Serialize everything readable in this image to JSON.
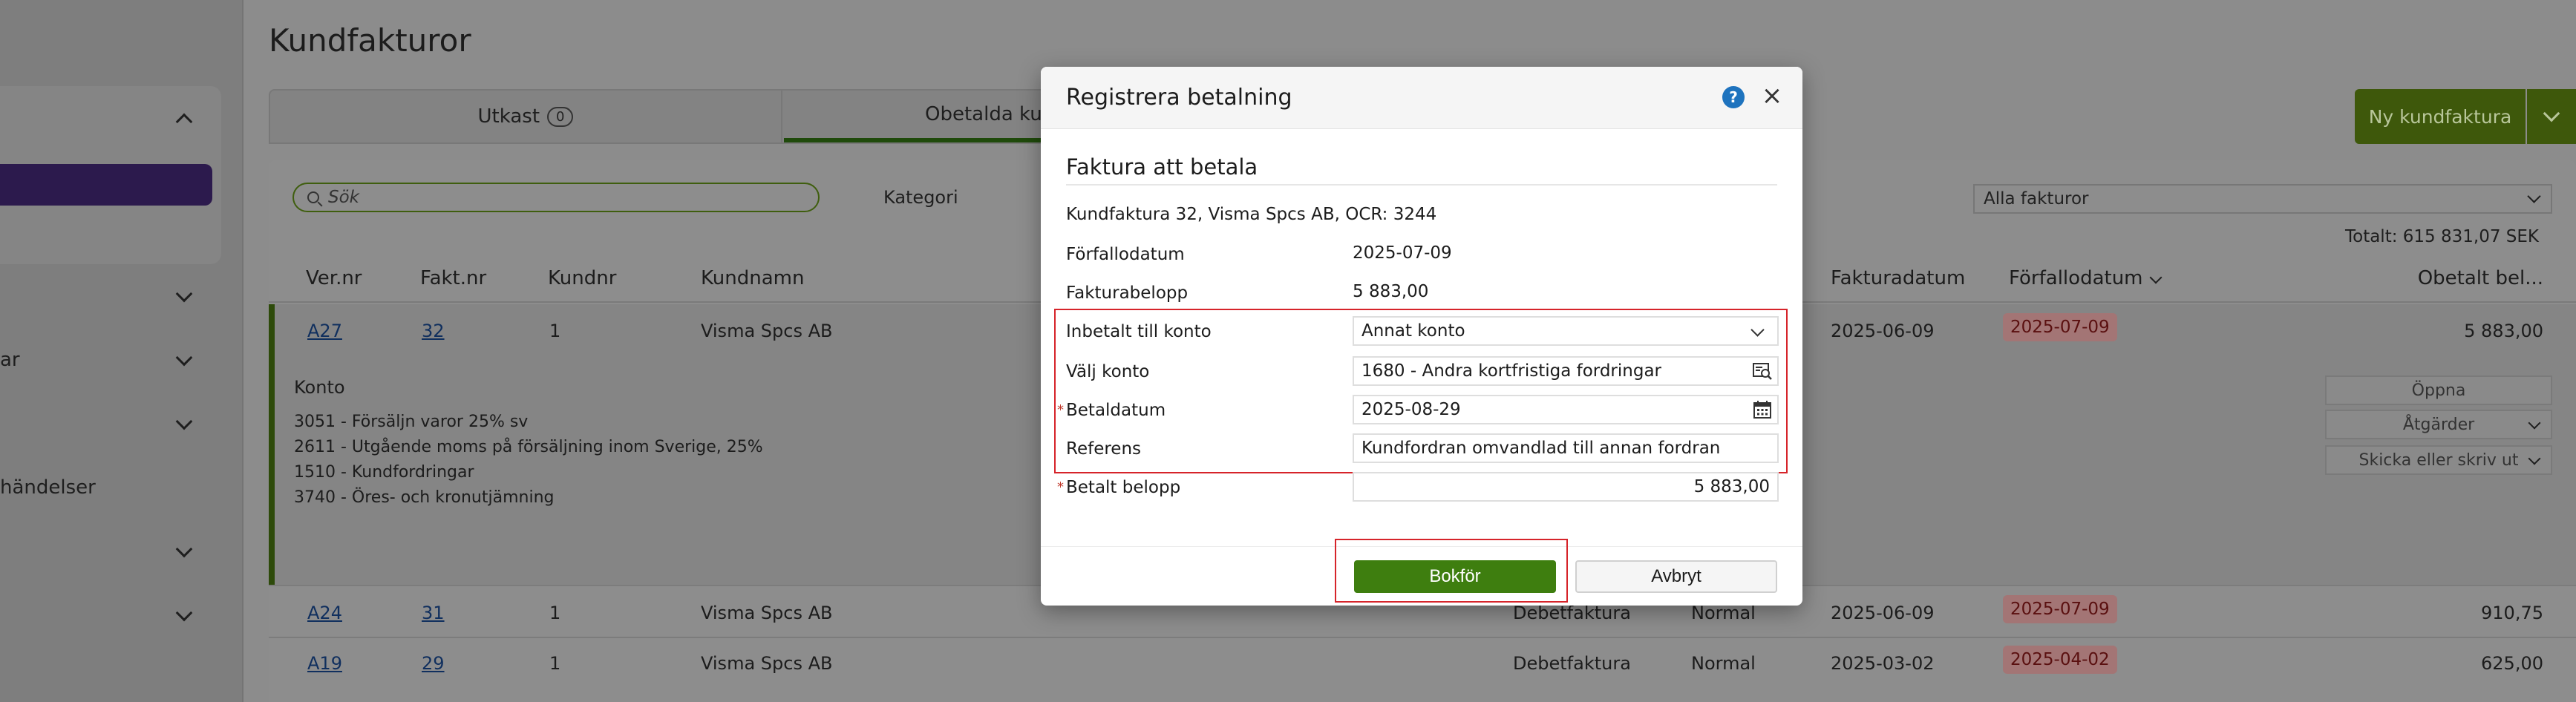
{
  "page": {
    "title": "Kundfakturor"
  },
  "sidebar": {
    "items": [
      {
        "label": ""
      },
      {
        "label": "ar"
      },
      {
        "label": "händelser"
      }
    ]
  },
  "tabs": [
    {
      "label": "Utkast",
      "count": "0"
    },
    {
      "label": "Obetalda kund"
    }
  ],
  "toolbar": {
    "new_invoice_label": "Ny kundfaktura",
    "search_placeholder": "Sök",
    "category_label": "Kategori",
    "filter_value": "Alla fakturor",
    "total": "Totalt: 615 831,07 SEK"
  },
  "table": {
    "columns": [
      "Ver.nr",
      "Fakt.nr",
      "Kundnr",
      "Kundnamn",
      "Fakturadatum",
      "Förfallodatum",
      "Obetalt bel..."
    ],
    "rows": [
      {
        "ver": "A27",
        "fakt": "32",
        "kund": "1",
        "namn": "Visma Spcs AB",
        "typ": "",
        "status": "",
        "fdatum": "2025-06-09",
        "due": "2025-07-09",
        "belopp": "5 883,00"
      },
      {
        "ver": "A24",
        "fakt": "31",
        "kund": "1",
        "namn": "Visma Spcs AB",
        "typ": "Debetfaktura",
        "status": "Normal",
        "fdatum": "2025-06-09",
        "due": "2025-07-09",
        "belopp": "910,75"
      },
      {
        "ver": "A19",
        "fakt": "29",
        "kund": "1",
        "namn": "Visma Spcs AB",
        "typ": "Debetfaktura",
        "status": "Normal",
        "fdatum": "2025-03-02",
        "due": "2025-04-02",
        "belopp": "625,00"
      }
    ],
    "expanded": {
      "konto_title": "Konto",
      "konto_lines": [
        "3051 - Försäljn varor 25% sv",
        "2611 - Utgående moms på försäljning inom Sverige, 25%",
        "1510 - Kundfordringar",
        "3740 - Öres- och kronutjämning"
      ],
      "actions": [
        "Öppna",
        "Åtgärder",
        "Skicka eller skriv ut"
      ]
    }
  },
  "modal": {
    "title": "Registrera betalning",
    "section_title": "Faktura att betala",
    "invoice_info": "Kundfaktura 32, Visma Spcs AB, OCR: 3244",
    "forfallodatum_label": "Förfallodatum",
    "forfallodatum_value": "2025-07-09",
    "fakturabelopp_label": "Fakturabelopp",
    "fakturabelopp_value": "5 883,00",
    "inbetalt_label": "Inbetalt till konto",
    "inbetalt_value": "Annat konto",
    "valj_konto_label": "Välj konto",
    "valj_konto_value": "1680 - Andra kortfristiga fordringar",
    "betaldatum_label": "Betaldatum",
    "betaldatum_value": "2025-08-29",
    "referens_label": "Referens",
    "referens_value": "Kundfordran omvandlad till annan fordran",
    "betalt_belopp_label": "Betalt belopp",
    "betalt_belopp_value": "5 883,00",
    "required_mark": "*",
    "help_glyph": "?",
    "close_glyph": "×",
    "bokfor_label": "Bokför",
    "avbryt_label": "Avbryt"
  },
  "colors": {
    "primary_green": "#3e7e0f",
    "highlight_red": "#d6242a",
    "help_blue": "#1e73be"
  }
}
